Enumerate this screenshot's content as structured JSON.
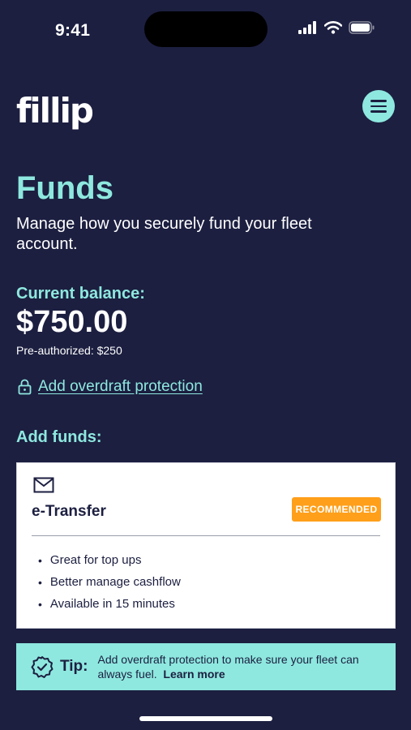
{
  "status_bar": {
    "time": "9:41"
  },
  "header": {
    "logo": "fillip",
    "menu_icon": "hamburger-menu-icon"
  },
  "page": {
    "title": "Funds",
    "subtitle": "Manage how you securely fund your fleet account."
  },
  "balance": {
    "label": "Current balance:",
    "amount": "$750.00",
    "preauthorized": "Pre-authorized: $250"
  },
  "overdraft": {
    "label": "Add overdraft protection",
    "icon": "lock-icon"
  },
  "add_funds": {
    "label": "Add funds:",
    "method": {
      "icon": "mail-icon",
      "title": "e-Transfer",
      "badge": "RECOMMENDED",
      "features": [
        "Great for top ups",
        "Better manage cashflow",
        "Available in 15 minutes"
      ]
    }
  },
  "tip": {
    "icon": "badge-check-icon",
    "label": "Tip:",
    "text": "Add overdraft protection to make sure your fleet can always fuel.",
    "link": "Learn more"
  },
  "colors": {
    "background": "#1c1f40",
    "accent": "#8ee8df",
    "badge": "#ff9f1a"
  }
}
